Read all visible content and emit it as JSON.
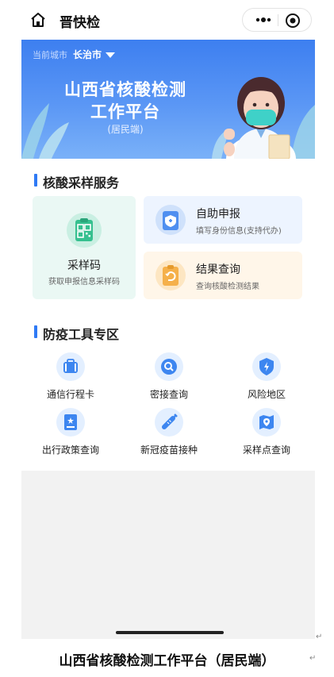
{
  "header": {
    "app_title": "晋快检",
    "home_icon": "home-icon",
    "more_icon": "more-dots-icon",
    "target_icon": "target-icon"
  },
  "banner": {
    "city_label": "当前城市",
    "city_value": "长治市",
    "title_line1": "山西省核酸检测",
    "title_line2": "工作平台",
    "subtitle": "(居民端)",
    "colors": {
      "top": "#3d7ff0",
      "bottom": "#7ab1f8"
    }
  },
  "services": {
    "section_title": "核酸采样服务",
    "sampling_code": {
      "title": "采样码",
      "desc": "获取申报信息采样码",
      "icon": "qr-code-icon"
    },
    "self_declare": {
      "title": "自助申报",
      "desc": "填写身份信息(支持代办)",
      "icon": "declare-shield-icon"
    },
    "result_query": {
      "title": "结果查询",
      "desc": "查询核酸检测结果",
      "icon": "result-report-icon"
    }
  },
  "tools": {
    "section_title": "防疫工具专区",
    "items": [
      {
        "label": "通信行程卡",
        "icon": "suitcase-icon"
      },
      {
        "label": "密接查询",
        "icon": "search-icon"
      },
      {
        "label": "风险地区",
        "icon": "lightning-shield-icon"
      },
      {
        "label": "出行政策查询",
        "icon": "policy-document-icon"
      },
      {
        "label": "新冠疫苗接种",
        "icon": "syringe-icon"
      },
      {
        "label": "采样点查询",
        "icon": "map-pin-icon"
      }
    ]
  },
  "caption": "山西省核酸检测工作平台（居民端）",
  "accent_color": "#2f7af5"
}
